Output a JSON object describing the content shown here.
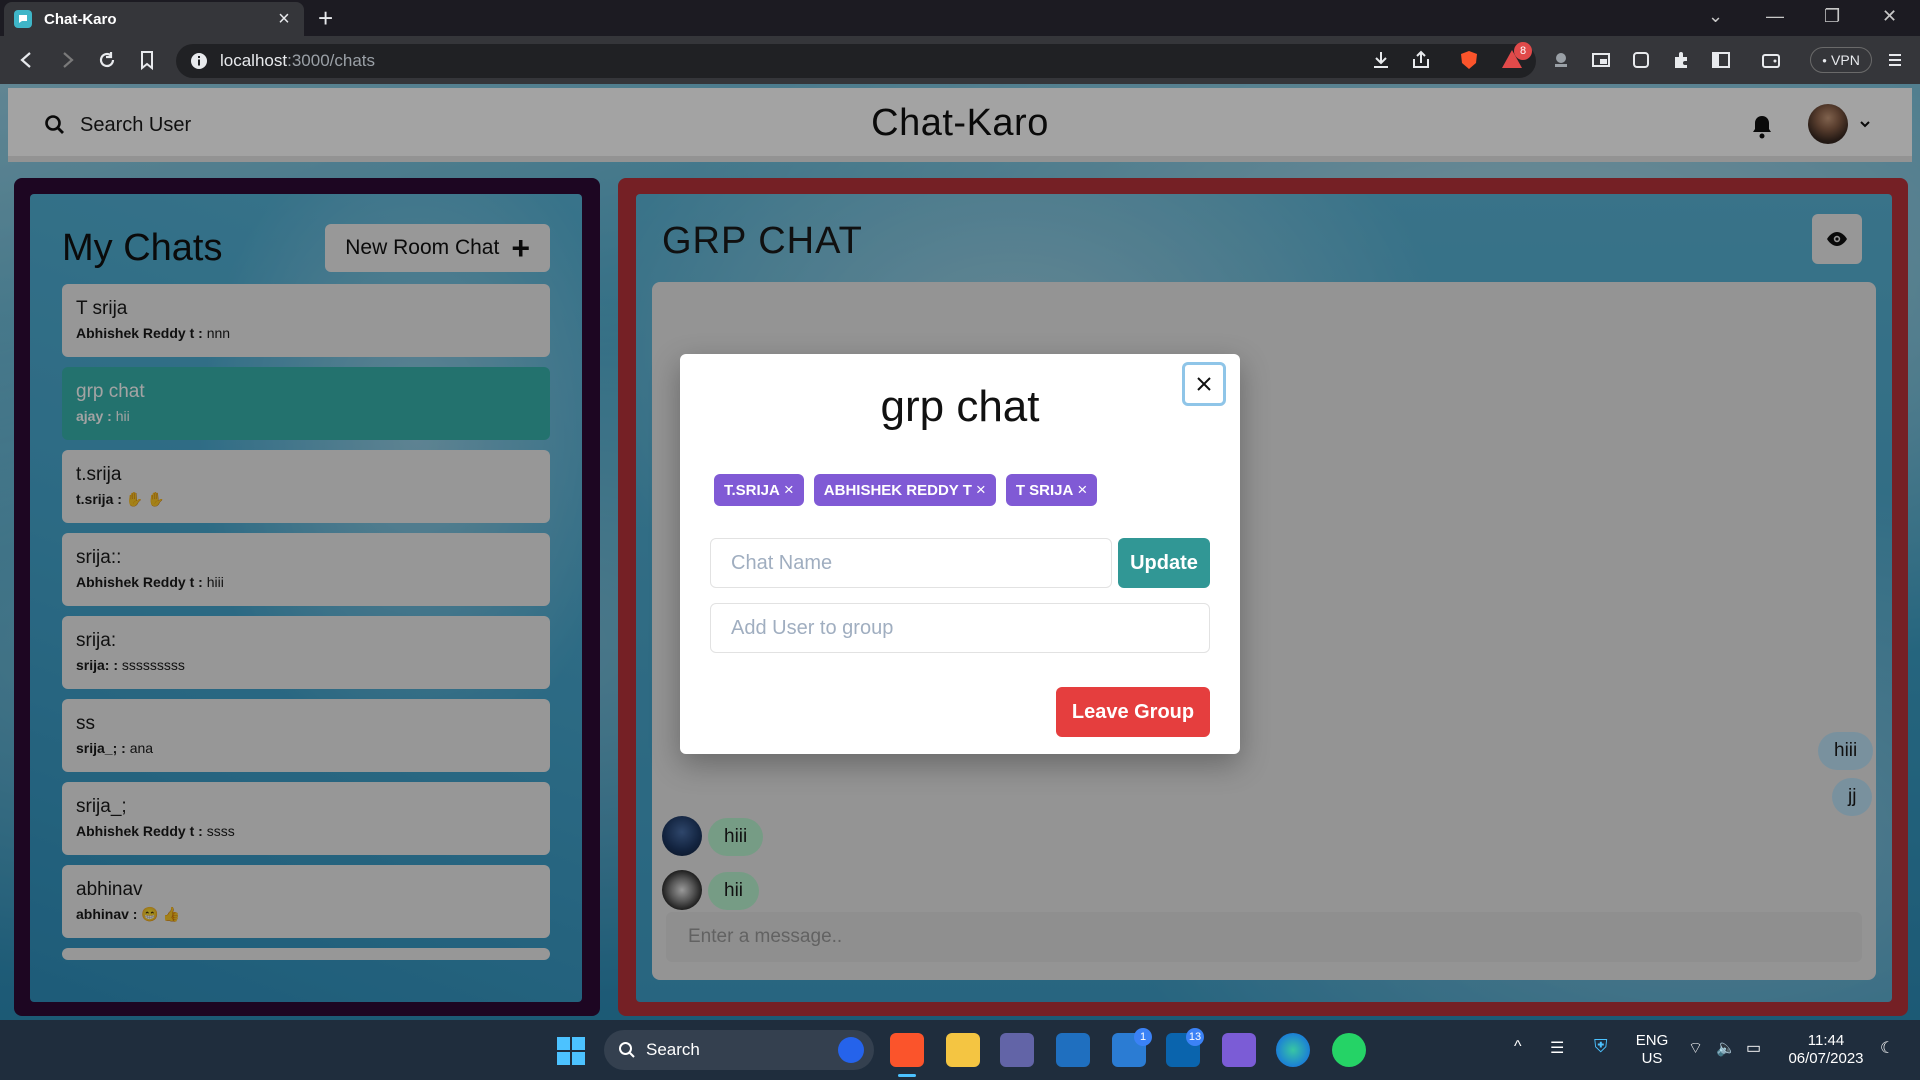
{
  "browser": {
    "tab_title": "Chat-Karo",
    "url_host": "localhost",
    "url_path": ":3000/chats",
    "vpn_label": "VPN",
    "brave_badge": "8"
  },
  "header": {
    "search_label": "Search User",
    "app_title": "Chat-Karo"
  },
  "sidebar": {
    "title": "My Chats",
    "new_room_label": "New Room Chat",
    "chats": [
      {
        "name": "T srija",
        "sender": "Abhishek Reddy t :",
        "message": "nnn"
      },
      {
        "name": "grp chat",
        "sender": "ajay :",
        "message": "hii"
      },
      {
        "name": "t.srija",
        "sender": "t.srija :",
        "message": "✋ ✋"
      },
      {
        "name": "srija::",
        "sender": "Abhishek Reddy t :",
        "message": "hiii"
      },
      {
        "name": "srija:",
        "sender": "srija: :",
        "message": "sssssssss"
      },
      {
        "name": "ss",
        "sender": "srija_; :",
        "message": "ana"
      },
      {
        "name": "srija_;",
        "sender": "Abhishek Reddy t :",
        "message": "ssss"
      },
      {
        "name": "abhinav",
        "sender": "abhinav :",
        "message": "😁 👍"
      }
    ]
  },
  "chat": {
    "title": "GRP CHAT",
    "messages_out": [
      "hiii",
      "jj"
    ],
    "messages_in": [
      "hiii",
      "hii"
    ],
    "input_placeholder": "Enter a message.."
  },
  "modal": {
    "title": "grp chat",
    "members": [
      "T.SRIJA",
      "ABHISHEK REDDY T",
      "T SRIJA"
    ],
    "chat_name_placeholder": "Chat Name",
    "update_label": "Update",
    "add_user_placeholder": "Add User to group",
    "leave_label": "Leave Group"
  },
  "taskbar": {
    "search_label": "Search",
    "lang_top": "ENG",
    "lang_bottom": "US",
    "time": "11:44",
    "date": "06/07/2023",
    "todo_badge": "1",
    "mail_badge": "13"
  },
  "colors": {
    "accent_teal": "#38b2ac",
    "tag_purple": "#805ad5",
    "leave_red": "#e53e3e",
    "update_teal": "#319795",
    "left_frame": "#2e0a36",
    "right_frame": "#b8333a"
  }
}
